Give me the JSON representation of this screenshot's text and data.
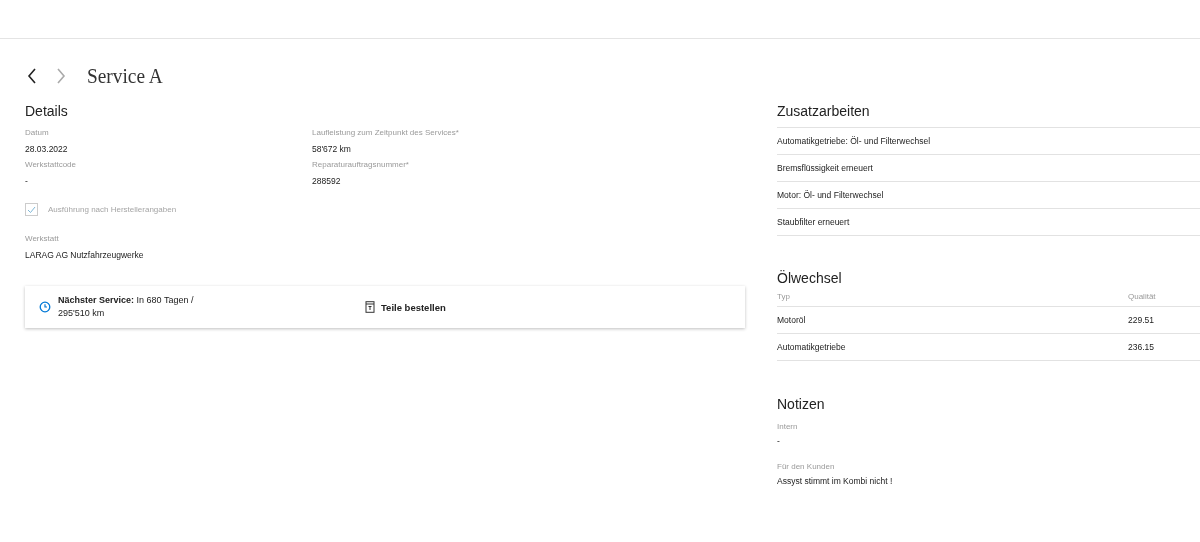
{
  "navigation": {
    "back": {
      "disabled": false
    },
    "forward": {
      "disabled": true
    }
  },
  "title": "Service A",
  "details": {
    "heading": "Details",
    "fields": [
      {
        "label": "Datum",
        "value": "28.03.2022"
      },
      {
        "label": "Laufleistung zum Zeitpunkt des Services*",
        "value": "58'672 km"
      },
      {
        "label": "Werkstattcode",
        "value": "-"
      },
      {
        "label": "Reparaturauftragsnummer*",
        "value": "288592"
      }
    ],
    "checkbox": {
      "label": "Ausführung nach Herstellerangaben",
      "checked": true,
      "disabled": true
    },
    "workshop": {
      "label": "Werkstatt",
      "value": "LARAG AG Nutzfahrzeugwerke"
    }
  },
  "next_service": {
    "text": "**Nächster Service:** In 680 Tagen / 295'510 km",
    "button": "Teile bestellen"
  },
  "additional_work": {
    "heading": "Zusatzarbeiten",
    "items": [
      "Automatikgetriebe: Öl- und Filterwechsel",
      "Bremsflüssigkeit erneuert",
      "Motor: Öl- und Filterwechsel",
      "Staubfilter erneuert"
    ]
  },
  "oil_change": {
    "heading": "Ölwechsel",
    "columns": [
      "Typ",
      "Qualität"
    ],
    "rows": [
      {
        "type": "Motoröl",
        "quality": "229.51"
      },
      {
        "type": "Automatikgetriebe",
        "quality": "236.15"
      }
    ]
  },
  "notes": {
    "heading": "Notizen",
    "fields": [
      {
        "label": "Intern",
        "value": "-"
      },
      {
        "label": "Für den Kunden",
        "value": "Assyst stimmt im Kombi nicht !"
      }
    ]
  }
}
